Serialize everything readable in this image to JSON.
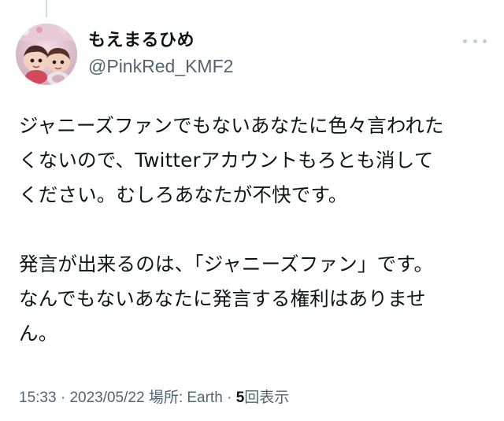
{
  "user": {
    "display_name": "もえまるひめ",
    "handle": "@PinkRed_KMF2",
    "avatar_icon": "avatar-photo"
  },
  "tweet": {
    "lines": [
      "ジャニーズファンでもないあなたに色々言われた",
      "くないので、Twitterアカウントもろとも消して",
      "ください。むしろあなたが不快です。",
      "",
      "発言が出来るのは、「ジャニーズファン」です。",
      "なんでもないあなたに発言する権利はありませ",
      "ん。"
    ]
  },
  "meta": {
    "time": "15:33",
    "separator1": " · ",
    "date": "2023/05/22",
    "location_label": "場所: Earth",
    "separator2": " · ",
    "views_count": "5",
    "views_label": "回表示"
  },
  "icons": {
    "more": "more-horizontal-icon"
  },
  "colors": {
    "text_primary": "#0f1419",
    "text_secondary": "#536471",
    "thread_line": "#cfd9de"
  }
}
